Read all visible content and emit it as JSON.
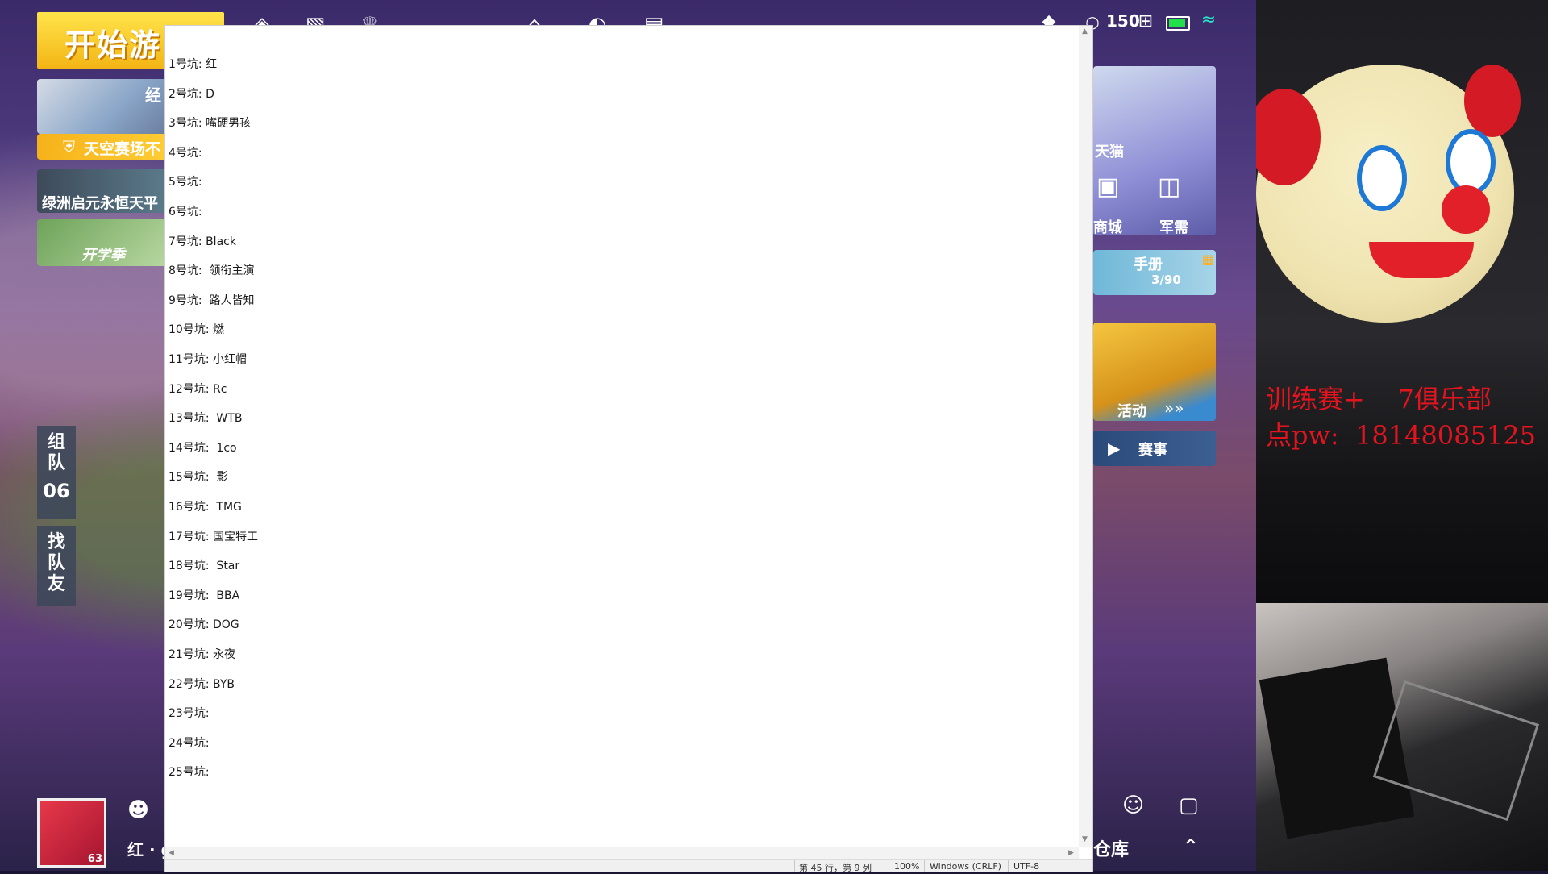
{
  "game": {
    "start_label": "开始游",
    "tile1_label": "经",
    "tile2_label": "天空赛场不",
    "tile3_label": "绿洲启元永恒天平",
    "tile4_label": "开学季",
    "team_tab": "组队",
    "team_number": "06",
    "find_tab": "找队友",
    "status_count": "150",
    "right_card1_label": "天猫",
    "shop_label": "商城",
    "military_label": "军需",
    "handbook_label": "手册",
    "handbook_progress": "3/90",
    "activity_label": "活动",
    "event_label": "赛事",
    "warehouse_label": "仓库",
    "player_name": "红 · g",
    "player_level": "63"
  },
  "notepad": {
    "lines": [
      "1号坑: 红",
      "2号坑: D",
      "3号坑: 嘴硬男孩",
      "4号坑:",
      "5号坑:",
      "6号坑:",
      "7号坑: Black",
      "8号坑:  领衔主演",
      "9号坑:  路人皆知",
      "10号坑: 燃",
      "11号坑: 小红帽",
      "12号坑: Rc",
      "13号坑:  WTB",
      "14号坑:  1co",
      "15号坑:  影",
      "16号坑:  TMG",
      "17号坑: 国宝特工",
      "18号坑:  Star",
      "19号坑:  BBA",
      "20号坑: DOG",
      "21号坑: 永夜",
      "22号坑: BYB",
      "23号坑:",
      "24号坑:",
      "25号坑:"
    ],
    "status_position": "第 45 行，第 9 列",
    "status_zoom": "100%",
    "status_eol": "Windows (CRLF)",
    "status_encoding": "UTF-8"
  },
  "overlay": {
    "line1": "训练赛+    7俱乐部",
    "line2": "点pw:  18148085125"
  },
  "icons": [
    "trophy-icon",
    "home-icon",
    "compass-icon",
    "calendar-icon",
    "wifi-icon",
    "battery-icon",
    "settings-icon",
    "chat-icon",
    "expand-icon"
  ]
}
